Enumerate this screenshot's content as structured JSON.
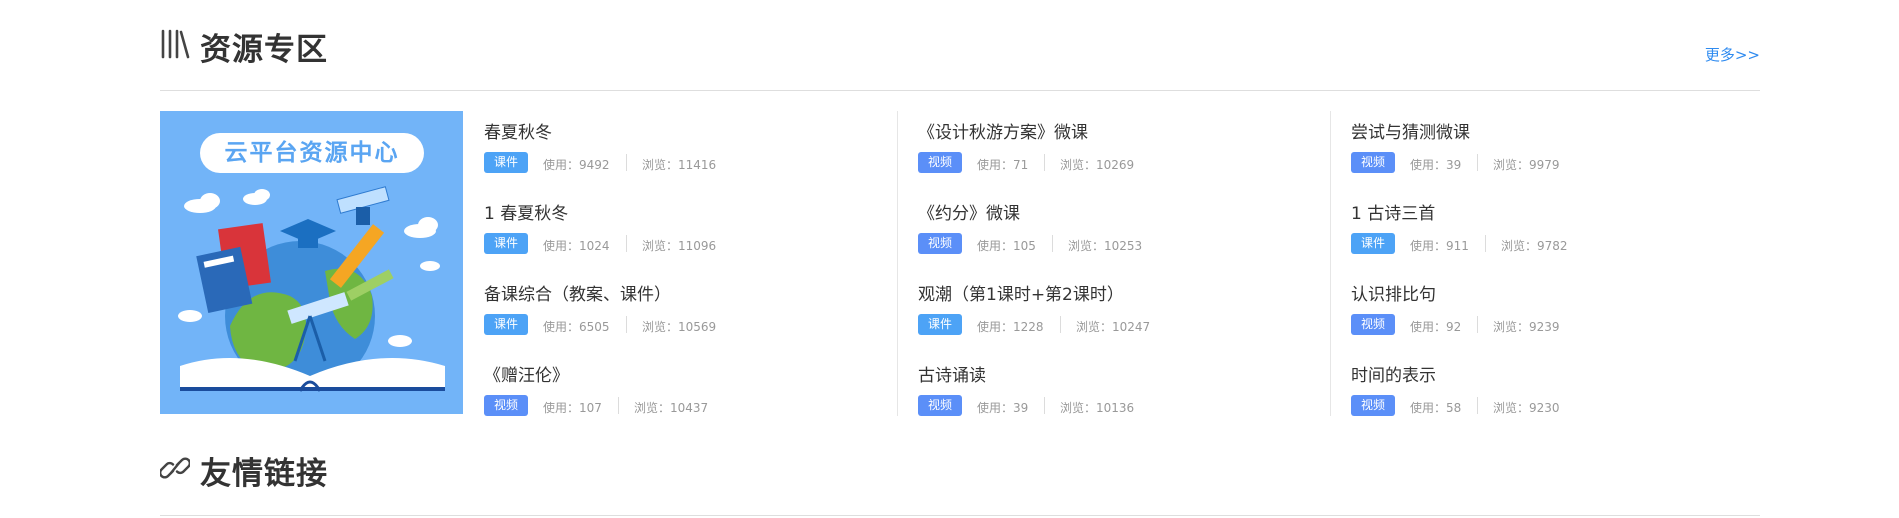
{
  "resource_section": {
    "title": "资源专区",
    "more": "更多>>",
    "cover_title": "云平台资源中心",
    "use_label": "使用：",
    "view_label": "浏览：",
    "columns": [
      [
        {
          "title": "春夏秋冬",
          "tag": "课件",
          "use": "9492",
          "view": "11416"
        },
        {
          "title": "1 春夏秋冬",
          "tag": "课件",
          "use": "1024",
          "view": "11096"
        },
        {
          "title": "备课综合（教案、课件）",
          "tag": "课件",
          "use": "6505",
          "view": "10569"
        },
        {
          "title": "《赠汪伦》",
          "tag": "视频",
          "use": "107",
          "view": "10437"
        }
      ],
      [
        {
          "title": "《设计秋游方案》微课",
          "tag": "视频",
          "use": "71",
          "view": "10269"
        },
        {
          "title": "《约分》微课",
          "tag": "视频",
          "use": "105",
          "view": "10253"
        },
        {
          "title": "观潮（第1课时+第2课时）",
          "tag": "课件",
          "use": "1228",
          "view": "10247"
        },
        {
          "title": "古诗诵读",
          "tag": "视频",
          "use": "39",
          "view": "10136"
        }
      ],
      [
        {
          "title": "尝试与猜测微课",
          "tag": "视频",
          "use": "39",
          "view": "9979"
        },
        {
          "title": "1 古诗三首",
          "tag": "课件",
          "use": "911",
          "view": "9782"
        },
        {
          "title": "认识排比句",
          "tag": "视频",
          "use": "92",
          "view": "9239"
        },
        {
          "title": "时间的表示",
          "tag": "视频",
          "use": "58",
          "view": "9230"
        }
      ]
    ]
  },
  "links_section": {
    "title": "友情链接"
  },
  "colors": {
    "accent": "#2f8bf0",
    "tag_courseware": "#4da3f6",
    "tag_video": "#5b8ff8",
    "cover_bg": "#72b4f8"
  }
}
